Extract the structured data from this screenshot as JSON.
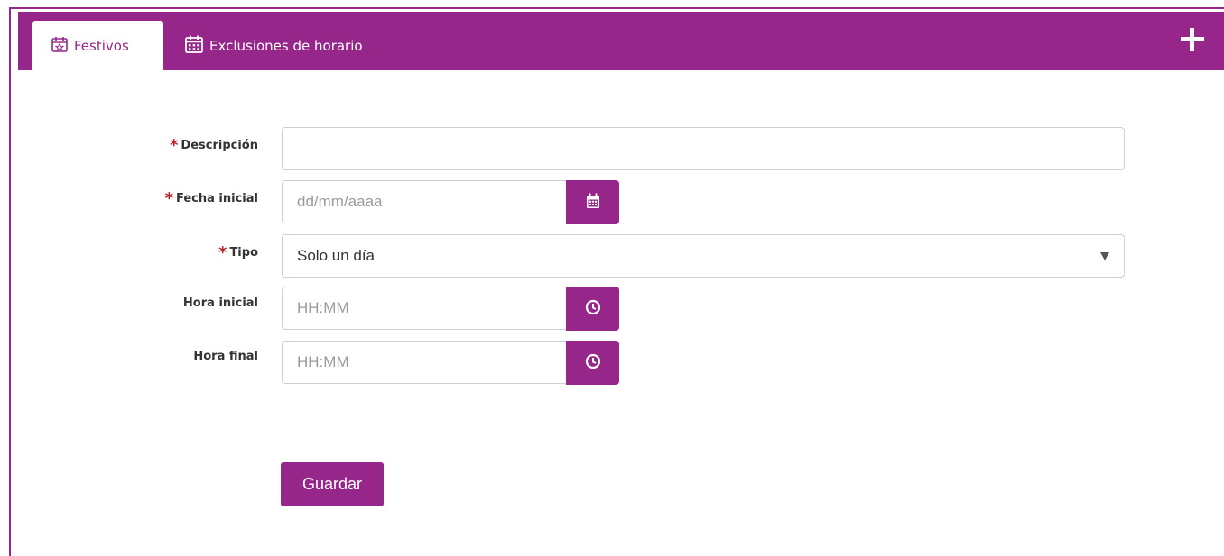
{
  "tabs": [
    {
      "label": "Festivos",
      "icon": "calendar-star-icon",
      "active": true
    },
    {
      "label": "Exclusiones de horario",
      "icon": "calendar-grid-icon",
      "active": false
    }
  ],
  "header": {
    "add_icon": "plus-icon"
  },
  "colors": {
    "accent": "#96268a",
    "required": "#b4232a"
  },
  "form": {
    "descripcion": {
      "label": "Descripción",
      "required": true,
      "value": "",
      "placeholder": ""
    },
    "fecha_inicial": {
      "label": "Fecha inicial",
      "required": true,
      "value": "",
      "placeholder": "dd/mm/aaaa",
      "icon": "calendar-icon"
    },
    "tipo": {
      "label": "Tipo",
      "required": true,
      "value": "Solo un día"
    },
    "hora_inicial": {
      "label": "Hora inicial",
      "required": false,
      "value": "",
      "placeholder": "HH:MM",
      "icon": "clock-icon"
    },
    "hora_final": {
      "label": "Hora final",
      "required": false,
      "value": "",
      "placeholder": "HH:MM",
      "icon": "clock-icon"
    },
    "required_marker": "*",
    "save_label": "Guardar"
  }
}
